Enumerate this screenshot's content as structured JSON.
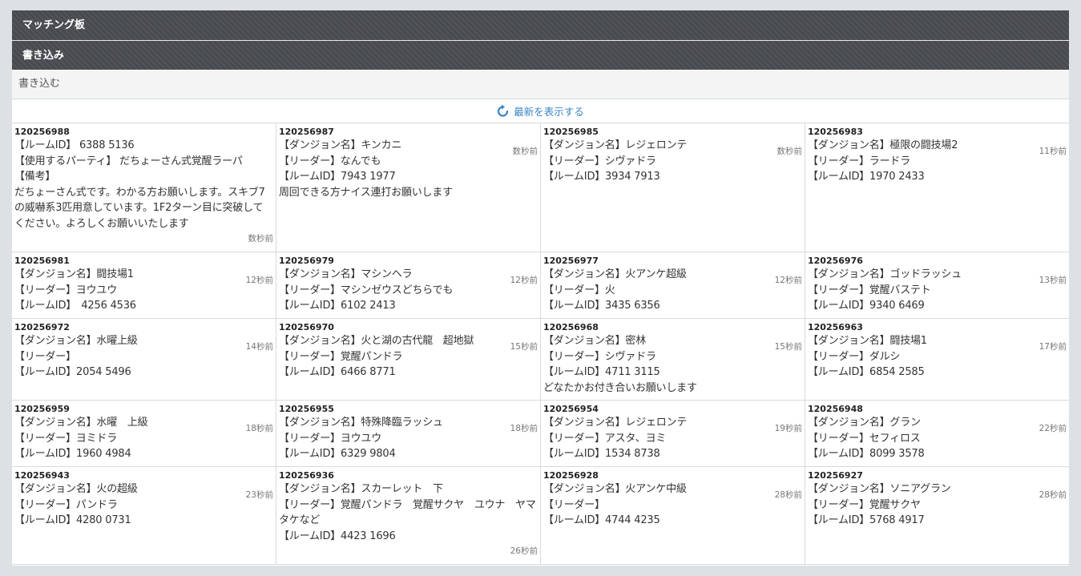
{
  "header": {
    "title": "マッチング板"
  },
  "subheader": {
    "title": "書き込み"
  },
  "write": {
    "label": "書き込む"
  },
  "refresh": {
    "label": "最新を表示する"
  },
  "colors": {
    "header_bg": "#474a4e",
    "link": "#3a84c5",
    "page_bg": "#dde1e4"
  },
  "posts": [
    {
      "id": "120256988",
      "body": "【ルームID】 6388 5136\n【使用するパーティ】 だちょーさん式覚醒ラーパ\n【備考】\nだちょーさん式です。わかる方お願いします。スキブ7の威嚇系3匹用意しています。1F2ターン目に突破してください。よろしくお願いいたします",
      "time": "数秒前"
    },
    {
      "id": "120256987",
      "body": "【ダンジョン名】キンカニ\n【リーダー】なんでも\n【ルームID】7943 1977\n周回できる方ナイス連打お願いします",
      "time": "数秒前"
    },
    {
      "id": "120256985",
      "body": "【ダンジョン名】レジェロンテ\n【リーダー】シヴァドラ\n【ルームID】3934 7913",
      "time": "数秒前"
    },
    {
      "id": "120256983",
      "body": "【ダンジョン名】極限の闘技場2\n【リーダー】ラードラ\n【ルームID】1970 2433",
      "time": "11秒前"
    },
    {
      "id": "120256981",
      "body": "【ダンジョン名】闘技場1\n【リーダー】ヨウユウ\n【ルームID】　4256 4536",
      "time": "12秒前"
    },
    {
      "id": "120256979",
      "body": "【ダンジョン名】マシンヘラ\n【リーダー】マシンゼウスどちらでも\n【ルームID】6102 2413",
      "time": "12秒前"
    },
    {
      "id": "120256977",
      "body": "【ダンジョン名】火アンケ超級\n【リーダー】火\n【ルームID】3435 6356",
      "time": "12秒前"
    },
    {
      "id": "120256976",
      "body": "【ダンジョン名】ゴッドラッシュ\n【リーダー】覚醒バステト\n【ルームID】9340 6469",
      "time": "13秒前"
    },
    {
      "id": "120256972",
      "body": "【ダンジョン名】水曜上級\n【リーダー】\n【ルームID】2054 5496",
      "time": "14秒前"
    },
    {
      "id": "120256970",
      "body": "【ダンジョン名】火と湖の古代龍　超地獄\n【リーダー】覚醒パンドラ\n【ルームID】6466 8771",
      "time": "15秒前"
    },
    {
      "id": "120256968",
      "body": "【ダンジョン名】密林\n【リーダー】シヴァドラ\n【ルームID】4711 3115\nどなたかお付き合いお願いします",
      "time": "15秒前"
    },
    {
      "id": "120256963",
      "body": "【ダンジョン名】闘技場1\n【リーダー】ダルシ\n【ルームID】6854 2585",
      "time": "17秒前"
    },
    {
      "id": "120256959",
      "body": "【ダンジョン名】水曜　上級\n【リーダー】ヨミドラ\n【ルームID】1960 4984",
      "time": "18秒前"
    },
    {
      "id": "120256955",
      "body": "【ダンジョン名】特殊降臨ラッシュ\n【リーダー】ヨウユウ\n【ルームID】6329 9804",
      "time": "18秒前"
    },
    {
      "id": "120256954",
      "body": "【ダンジョン名】レジェロンテ\n【リーダー】アスタ、ヨミ\n【ルームID】1534 8738",
      "time": "19秒前"
    },
    {
      "id": "120256948",
      "body": "【ダンジョン名】グラン\n【リーダー】セフィロス\n【ルームID】8099 3578",
      "time": "22秒前"
    },
    {
      "id": "120256943",
      "body": "【ダンジョン名】火の超級\n【リーダー】パンドラ\n【ルームID】4280 0731",
      "time": "23秒前"
    },
    {
      "id": "120256936",
      "body": "【ダンジョン名】スカーレット　下\n【リーダー】覚醒パンドラ　覚醒サクヤ　ユウナ　ヤマタケなど\n【ルームID】4423 1696",
      "time": "26秒前"
    },
    {
      "id": "120256928",
      "body": "【ダンジョン名】火アンケ中級\n【リーダー】\n【ルームID】4744 4235",
      "time": "28秒前"
    },
    {
      "id": "120256927",
      "body": "【ダンジョン名】ソニアグラン\n【リーダー】覚醒サクヤ\n【ルームID】5768 4917",
      "time": "28秒前"
    }
  ]
}
